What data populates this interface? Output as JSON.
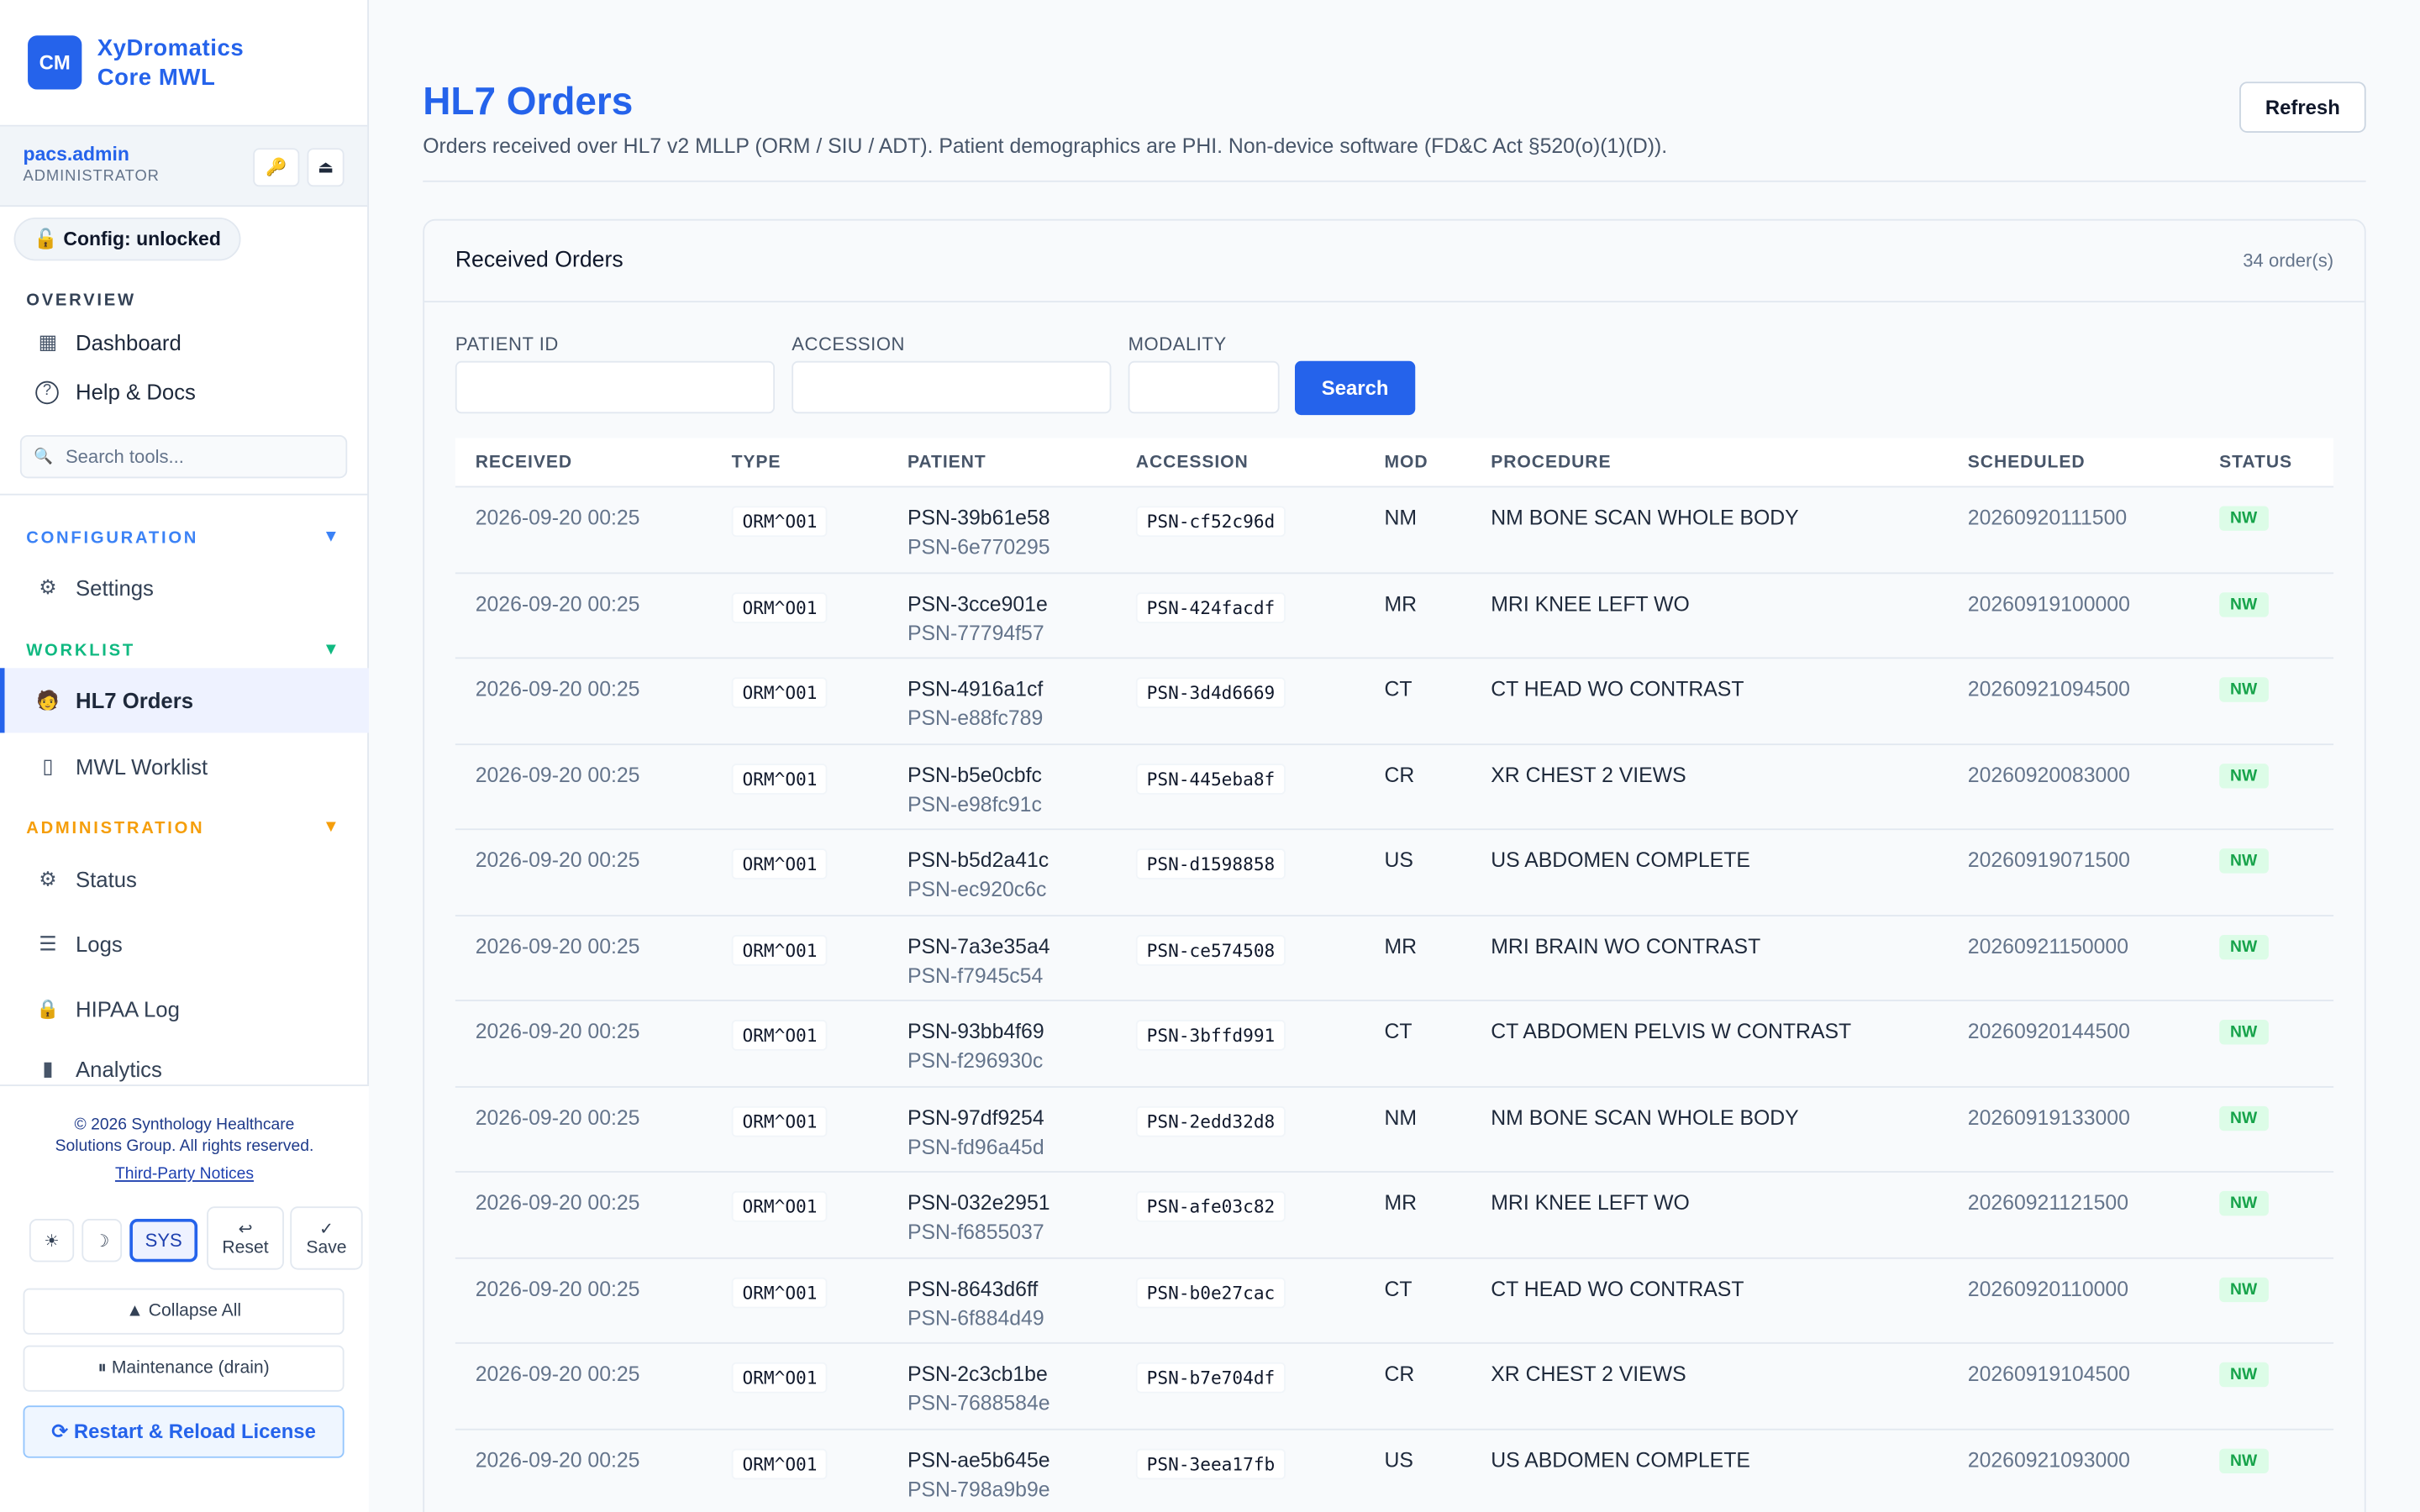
{
  "brand": {
    "logo": "CM",
    "line1": "XyDromatics",
    "line2": "Core MWL"
  },
  "user": {
    "name": "pacs.admin",
    "role": "ADMINISTRATOR",
    "key_icon": "🔑",
    "eject_icon": "⏏"
  },
  "config_badge": "🔓 Config: unlocked",
  "sections": {
    "overview": "OVERVIEW",
    "configuration": "CONFIGURATION",
    "worklist": "WORKLIST",
    "administration": "ADMINISTRATION",
    "arrow": "▼"
  },
  "nav": {
    "dashboard": "Dashboard",
    "help": "Help & Docs",
    "settings": "Settings",
    "hl7": "HL7 Orders",
    "mwl": "MWL Worklist",
    "status": "Status",
    "logs": "Logs",
    "hipaa": "HIPAA Log",
    "analytics": "Analytics"
  },
  "icons": {
    "dashboard": "▦",
    "help": "?",
    "settings": "⚙",
    "hl7": "🧑",
    "mwl": "▯",
    "status": "⚙",
    "logs": "☰",
    "hipaa": "🔒",
    "analytics": "▮",
    "search": "🔍"
  },
  "search_tools": "Search tools...",
  "footer": {
    "copyright_1": "© 2026 Synthology Healthcare",
    "copyright_2": "Solutions Group. All rights reserved.",
    "third_party": "Third-Party Notices",
    "light": "☀",
    "dark": "☽",
    "sys": "SYS",
    "reset_icon": "↩",
    "reset": "Reset",
    "save_icon": "✓",
    "save": "Save",
    "collapse": "▲ Collapse All",
    "maintenance": "⏸ Maintenance (drain)",
    "restart": "⟳ Restart & Reload License"
  },
  "page": {
    "title": "HL7 Orders",
    "subtitle": "Orders received over HL7 v2 MLLP (ORM / SIU / ADT). Patient demographics are PHI. Non-device software (FD&C Act §520(o)(1)(D)).",
    "refresh": "Refresh"
  },
  "card": {
    "title": "Received Orders",
    "count": "34 order(s)"
  },
  "filters": {
    "patient_id": "PATIENT ID",
    "accession": "ACCESSION",
    "modality": "MODALITY",
    "search": "Search"
  },
  "columns": [
    "RECEIVED",
    "TYPE",
    "PATIENT",
    "ACCESSION",
    "MOD",
    "PROCEDURE",
    "SCHEDULED",
    "STATUS"
  ],
  "rows": [
    {
      "received": "2026-09-20 00:25",
      "type": "ORM^O01",
      "patient": "PSN-39b61e58",
      "patient_sub": "PSN-6e770295",
      "accession": "PSN-cf52c96d",
      "mod": "NM",
      "procedure": "NM BONE SCAN WHOLE BODY",
      "scheduled": "20260920111500",
      "status": "NW"
    },
    {
      "received": "2026-09-20 00:25",
      "type": "ORM^O01",
      "patient": "PSN-3cce901e",
      "patient_sub": "PSN-77794f57",
      "accession": "PSN-424facdf",
      "mod": "MR",
      "procedure": "MRI KNEE LEFT WO",
      "scheduled": "20260919100000",
      "status": "NW"
    },
    {
      "received": "2026-09-20 00:25",
      "type": "ORM^O01",
      "patient": "PSN-4916a1cf",
      "patient_sub": "PSN-e88fc789",
      "accession": "PSN-3d4d6669",
      "mod": "CT",
      "procedure": "CT HEAD WO CONTRAST",
      "scheduled": "20260921094500",
      "status": "NW"
    },
    {
      "received": "2026-09-20 00:25",
      "type": "ORM^O01",
      "patient": "PSN-b5e0cbfc",
      "patient_sub": "PSN-e98fc91c",
      "accession": "PSN-445eba8f",
      "mod": "CR",
      "procedure": "XR CHEST 2 VIEWS",
      "scheduled": "20260920083000",
      "status": "NW"
    },
    {
      "received": "2026-09-20 00:25",
      "type": "ORM^O01",
      "patient": "PSN-b5d2a41c",
      "patient_sub": "PSN-ec920c6c",
      "accession": "PSN-d1598858",
      "mod": "US",
      "procedure": "US ABDOMEN COMPLETE",
      "scheduled": "20260919071500",
      "status": "NW"
    },
    {
      "received": "2026-09-20 00:25",
      "type": "ORM^O01",
      "patient": "PSN-7a3e35a4",
      "patient_sub": "PSN-f7945c54",
      "accession": "PSN-ce574508",
      "mod": "MR",
      "procedure": "MRI BRAIN WO CONTRAST",
      "scheduled": "20260921150000",
      "status": "NW"
    },
    {
      "received": "2026-09-20 00:25",
      "type": "ORM^O01",
      "patient": "PSN-93bb4f69",
      "patient_sub": "PSN-f296930c",
      "accession": "PSN-3bffd991",
      "mod": "CT",
      "procedure": "CT ABDOMEN PELVIS W CONTRAST",
      "scheduled": "20260920144500",
      "status": "NW"
    },
    {
      "received": "2026-09-20 00:25",
      "type": "ORM^O01",
      "patient": "PSN-97df9254",
      "patient_sub": "PSN-fd96a45d",
      "accession": "PSN-2edd32d8",
      "mod": "NM",
      "procedure": "NM BONE SCAN WHOLE BODY",
      "scheduled": "20260919133000",
      "status": "NW"
    },
    {
      "received": "2026-09-20 00:25",
      "type": "ORM^O01",
      "patient": "PSN-032e2951",
      "patient_sub": "PSN-f6855037",
      "accession": "PSN-afe03c82",
      "mod": "MR",
      "procedure": "MRI KNEE LEFT WO",
      "scheduled": "20260921121500",
      "status": "NW"
    },
    {
      "received": "2026-09-20 00:25",
      "type": "ORM^O01",
      "patient": "PSN-8643d6ff",
      "patient_sub": "PSN-6f884d49",
      "accession": "PSN-b0e27cac",
      "mod": "CT",
      "procedure": "CT HEAD WO CONTRAST",
      "scheduled": "20260920110000",
      "status": "NW"
    },
    {
      "received": "2026-09-20 00:25",
      "type": "ORM^O01",
      "patient": "PSN-2c3cb1be",
      "patient_sub": "PSN-7688584e",
      "accession": "PSN-b7e704df",
      "mod": "CR",
      "procedure": "XR CHEST 2 VIEWS",
      "scheduled": "20260919104500",
      "status": "NW"
    },
    {
      "received": "2026-09-20 00:25",
      "type": "ORM^O01",
      "patient": "PSN-ae5b645e",
      "patient_sub": "PSN-798a9b9e",
      "accession": "PSN-3eea17fb",
      "mod": "US",
      "procedure": "US ABDOMEN COMPLETE",
      "scheduled": "20260921093000",
      "status": "NW"
    }
  ],
  "colors": {
    "accent": "#2563eb",
    "config_section": "#3b82f6",
    "worklist_section": "#10b981",
    "admin_section": "#f59e0b",
    "status_ok": "#16a34a"
  }
}
